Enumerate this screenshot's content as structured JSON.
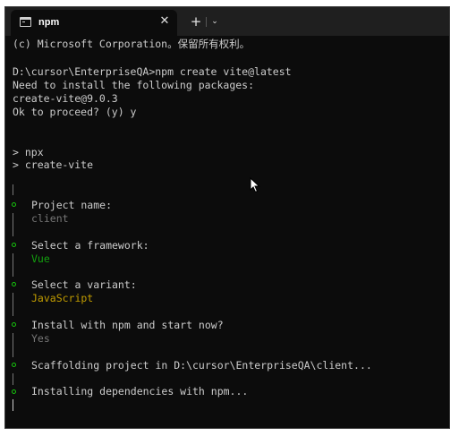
{
  "window": {
    "tab_title": "npm",
    "close_glyph": "✕",
    "new_tab_glyph": "+",
    "dropdown_glyph": "⌄",
    "tab_icon": "terminal-icon"
  },
  "terminal": {
    "copyright": "(c) Microsoft Corporation。保留所有权利。",
    "command_line": "D:\\cursor\\EnterpriseQA>npm create vite@latest",
    "need_install": "Need to install the following packages:",
    "package": "create-vite@9.0.3",
    "proceed": "Ok to proceed? (y) y",
    "npx": "> npx",
    "create_vite": "> create-vite",
    "prompts": {
      "project_name_label": "Project name:",
      "project_name_value": "client",
      "framework_label": "Select a framework:",
      "framework_value": "Vue",
      "variant_label": "Select a variant:",
      "variant_value": "JavaScript",
      "install_label": "Install with npm and start now?",
      "install_value": "Yes",
      "scaffolding": "Scaffolding project in D:\\cursor\\EnterpriseQA\\client...",
      "installing": "Installing dependencies with npm..."
    }
  },
  "colors": {
    "background": "#0c0c0c",
    "text": "#cccccc",
    "dot_green": "#16c60c",
    "muted": "#767676",
    "vue_green": "#13a10e",
    "js_yellow": "#c19c00"
  }
}
